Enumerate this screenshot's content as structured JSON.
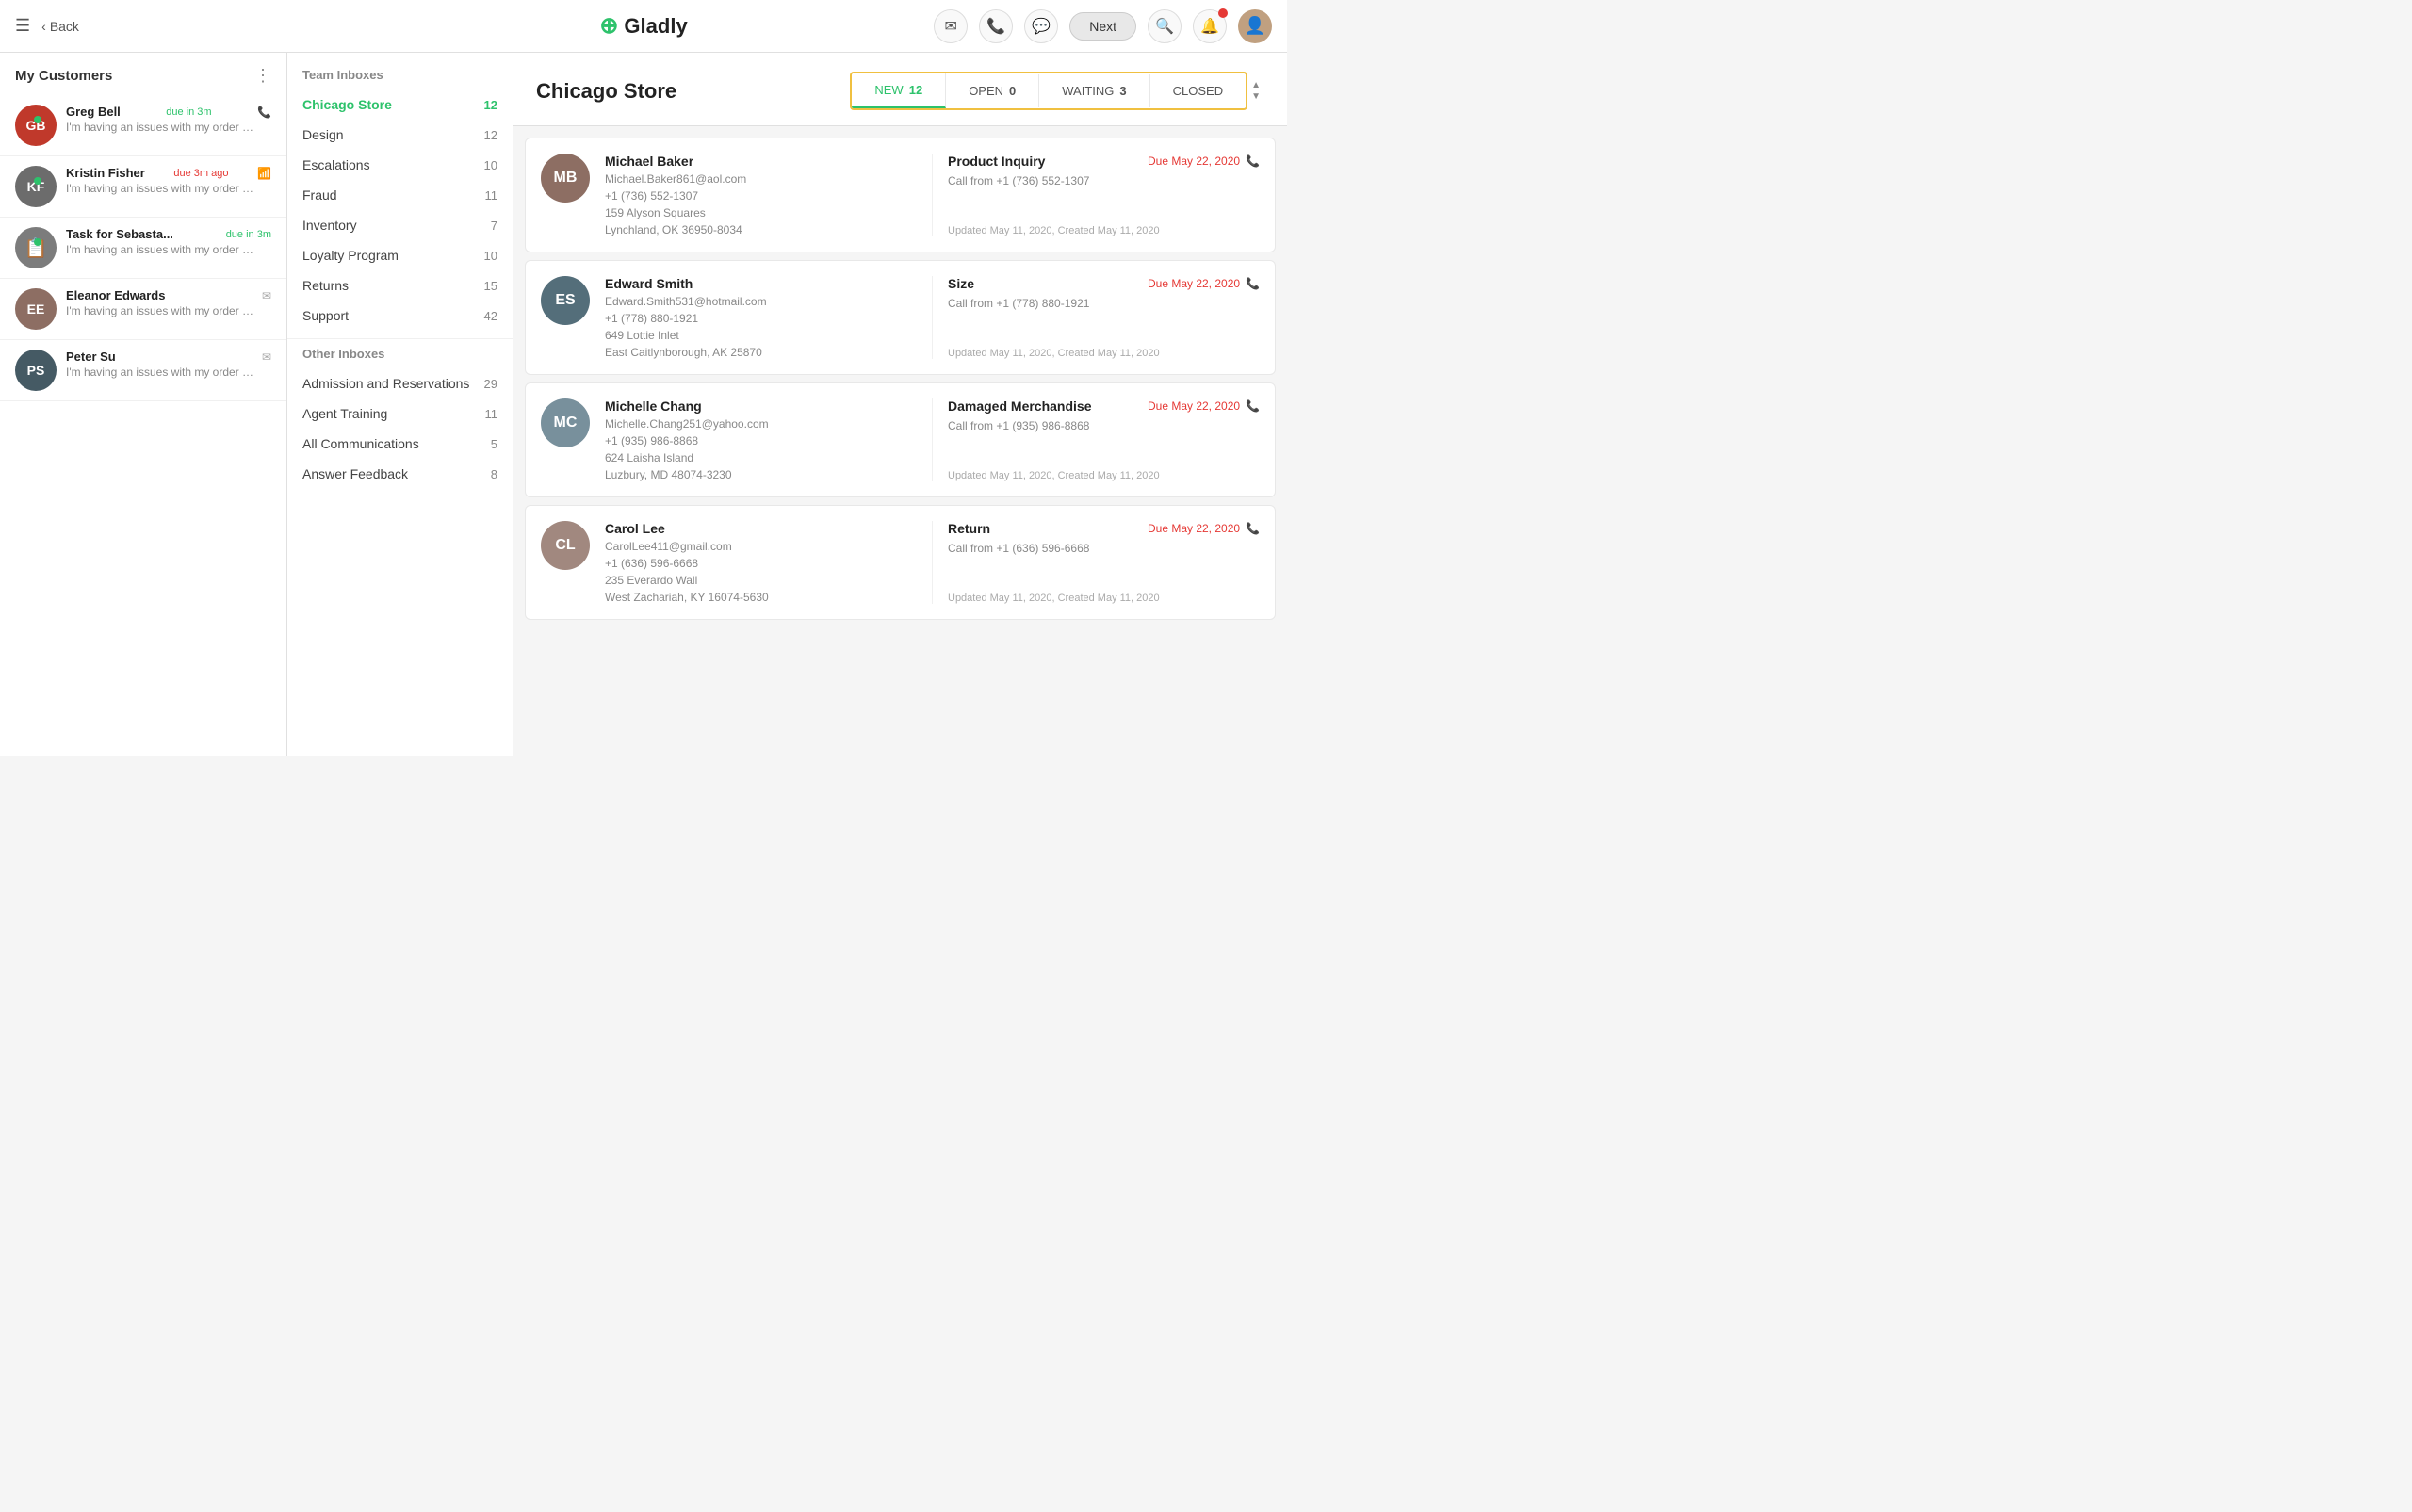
{
  "nav": {
    "menu_icon": "☰",
    "back_label": "Back",
    "logo_text": "Gladly",
    "logo_icon": "⊕",
    "next_label": "Next",
    "search_icon": "🔍",
    "bell_icon": "🔔",
    "mail_icon": "✉",
    "phone_icon": "📞",
    "chat_icon": "💬"
  },
  "customers_panel": {
    "title": "My Customers",
    "customers": [
      {
        "id": "greg-bell",
        "name": "Greg Bell",
        "meta": "due in 3m",
        "meta_type": "due",
        "preview": "I'm having an issues with my order that was recently shipped...",
        "online": true,
        "avatar_color": "#c0392b",
        "initials": "GB",
        "icon": "📞"
      },
      {
        "id": "kristin-fisher",
        "name": "Kristin Fisher",
        "meta": "due 3m ago",
        "meta_type": "overdue",
        "preview": "I'm having an issues with my order that was recently shipped...",
        "online": true,
        "avatar_color": "#6c6c6c",
        "initials": "KF",
        "icon": "📶"
      },
      {
        "id": "task-sebasta",
        "name": "Task for Sebasta...",
        "meta": "due in 3m",
        "meta_type": "due",
        "preview": "I'm having an issues with my order that was recently shipped...",
        "online": true,
        "avatar_color": "#7c7c7c",
        "initials": "📋",
        "icon": ""
      },
      {
        "id": "eleanor-edwards",
        "name": "Eleanor Edwards",
        "meta": "",
        "meta_type": "",
        "preview": "I'm having an issues with my order that was recently shipped...",
        "online": false,
        "avatar_color": "#8d6e63",
        "initials": "EE",
        "icon": "✉"
      },
      {
        "id": "peter-su",
        "name": "Peter Su",
        "meta": "",
        "meta_type": "",
        "preview": "I'm having an issues with my order that was recently shipped...",
        "online": false,
        "avatar_color": "#455a64",
        "initials": "PS",
        "icon": "✉"
      }
    ]
  },
  "team_inboxes": {
    "section_title": "Team Inboxes",
    "items": [
      {
        "id": "chicago-store",
        "label": "Chicago Store",
        "count": 12,
        "active": true
      },
      {
        "id": "design",
        "label": "Design",
        "count": 12,
        "active": false
      },
      {
        "id": "escalations",
        "label": "Escalations",
        "count": 10,
        "active": false
      },
      {
        "id": "fraud",
        "label": "Fraud",
        "count": 11,
        "active": false
      },
      {
        "id": "inventory",
        "label": "Inventory",
        "count": 7,
        "active": false
      },
      {
        "id": "loyalty-program",
        "label": "Loyalty Program",
        "count": 10,
        "active": false
      },
      {
        "id": "returns",
        "label": "Returns",
        "count": 15,
        "active": false
      },
      {
        "id": "support",
        "label": "Support",
        "count": 42,
        "active": false
      }
    ]
  },
  "other_inboxes": {
    "section_title": "Other Inboxes",
    "items": [
      {
        "id": "admission",
        "label": "Admission and Reservations",
        "count": 29,
        "active": false
      },
      {
        "id": "agent-training",
        "label": "Agent Training",
        "count": 11,
        "active": false
      },
      {
        "id": "all-comms",
        "label": "All Communications",
        "count": 5,
        "active": false
      },
      {
        "id": "answer-feedback",
        "label": "Answer Feedback",
        "count": 8,
        "active": false
      }
    ]
  },
  "content": {
    "title": "Chicago Store",
    "tabs": [
      {
        "id": "new",
        "label": "NEW",
        "count": 12,
        "active": true
      },
      {
        "id": "open",
        "label": "OPEN",
        "count": 0,
        "active": false
      },
      {
        "id": "waiting",
        "label": "WAITING",
        "count": 3,
        "active": false
      },
      {
        "id": "closed",
        "label": "CLOSED",
        "count": null,
        "active": false
      }
    ],
    "conversations": [
      {
        "id": "conv-1",
        "name": "Michael Baker",
        "email": "Michael.Baker861@aol.com",
        "phone": "+1 (736) 552-1307",
        "address1": "159 Alyson Squares",
        "address2": "Lynchland, OK 36950-8034",
        "subject": "Product Inquiry",
        "source": "Call from +1 (736) 552-1307",
        "due": "Due May 22, 2020",
        "updated": "Updated May 11, 2020, Created May 11, 2020",
        "avatar_color": "#8d6e63"
      },
      {
        "id": "conv-2",
        "name": "Edward Smith",
        "email": "Edward.Smith531@hotmail.com",
        "phone": "+1 (778) 880-1921",
        "address1": "649 Lottie Inlet",
        "address2": "East Caitlynborough, AK 25870",
        "subject": "Size",
        "source": "Call from +1 (778) 880-1921",
        "due": "Due May 22, 2020",
        "updated": "Updated May 11, 2020, Created May 11, 2020",
        "avatar_color": "#546e7a"
      },
      {
        "id": "conv-3",
        "name": "Michelle Chang",
        "email": "Michelle.Chang251@yahoo.com",
        "phone": "+1 (935) 986-8868",
        "address1": "624 Laisha Island",
        "address2": "Luzbury, MD 48074-3230",
        "subject": "Damaged Merchandise",
        "source": "Call from +1 (935) 986-8868",
        "due": "Due May 22, 2020",
        "updated": "Updated May 11, 2020, Created May 11, 2020",
        "avatar_color": "#78909c"
      },
      {
        "id": "conv-4",
        "name": "Carol Lee",
        "email": "CarolLee411@gmail.com",
        "phone": "+1 (636) 596-6668",
        "address1": "235 Everardo Wall",
        "address2": "West Zachariah, KY 16074-5630",
        "subject": "Return",
        "source": "Call from +1 (636) 596-6668",
        "due": "Due May 22, 2020",
        "updated": "Updated May 11, 2020, Created May 11, 2020",
        "avatar_color": "#a1887f"
      }
    ]
  }
}
